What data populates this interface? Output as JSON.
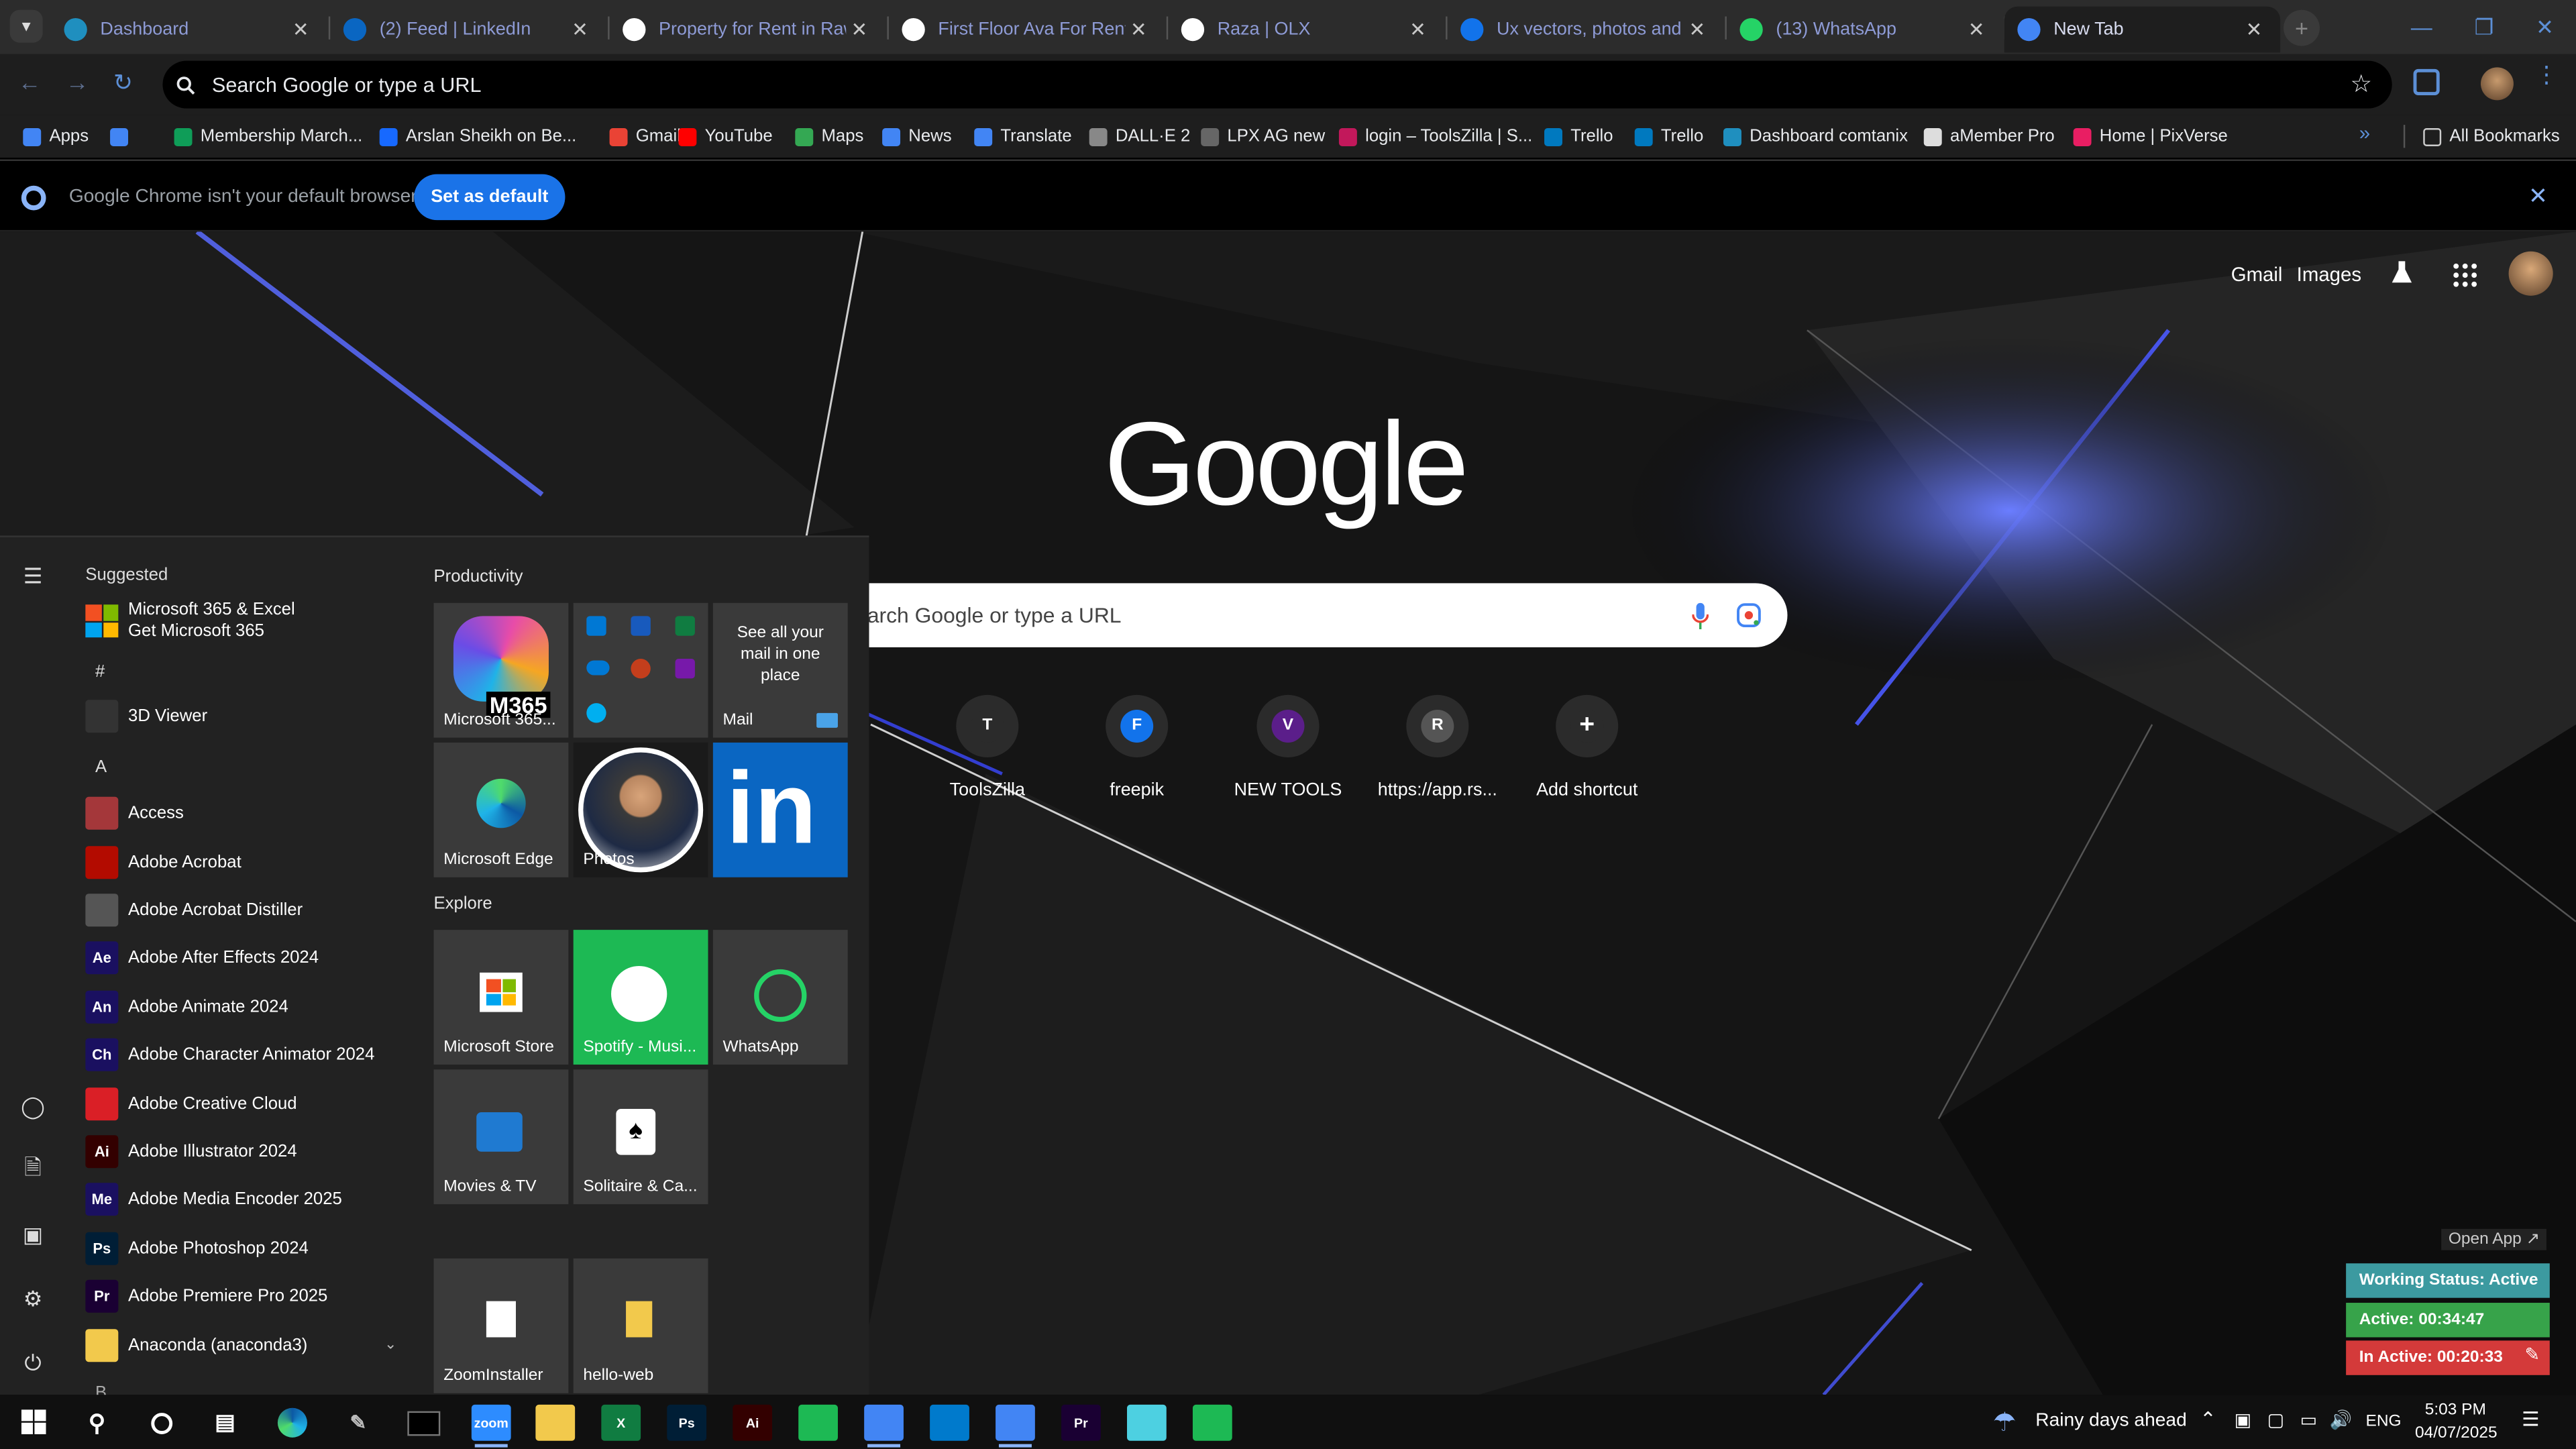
{
  "tabs": [
    {
      "title": "Dashboard",
      "icon": "dashboard-favicon",
      "color": "#1f8fbf"
    },
    {
      "title": "(2) Feed | LinkedIn",
      "icon": "linkedin-favicon",
      "color": "#0a66c2"
    },
    {
      "title": "Property for Rent in Rawa",
      "icon": "olx-favicon",
      "color": "#ffffff"
    },
    {
      "title": "First Floor Ava For Rent A",
      "icon": "olx-favicon",
      "color": "#ffffff"
    },
    {
      "title": "Raza | OLX",
      "icon": "olx-favicon",
      "color": "#ffffff"
    },
    {
      "title": "Ux vectors, photos and PS",
      "icon": "freepik-favicon",
      "color": "#1273eb"
    },
    {
      "title": "(13) WhatsApp",
      "icon": "whatsapp-favicon",
      "color": "#25d366"
    },
    {
      "title": "New Tab",
      "icon": "chrome-favicon",
      "color": "#4285f4"
    }
  ],
  "omnibox": {
    "text": "Search Google or type a URL"
  },
  "bookmarks": [
    {
      "label": "Apps",
      "color": "#4285f4"
    },
    {
      "label": "",
      "color": "#4285f4"
    },
    {
      "label": "Membership March...",
      "color": "#0f9d58"
    },
    {
      "label": "Arslan Sheikh on Be...",
      "color": "#1769ff"
    },
    {
      "label": "Gmail",
      "color": "#ea4335"
    },
    {
      "label": "YouTube",
      "color": "#ff0000"
    },
    {
      "label": "Maps",
      "color": "#34a853"
    },
    {
      "label": "News",
      "color": "#4285f4"
    },
    {
      "label": "Translate",
      "color": "#4285f4"
    },
    {
      "label": "DALL·E 2",
      "color": "#888888"
    },
    {
      "label": "LPX AG new",
      "color": "#666666"
    },
    {
      "label": "login – ToolsZilla | S...",
      "color": "#c2185b"
    },
    {
      "label": "Trello",
      "color": "#0079bf"
    },
    {
      "label": "Trello",
      "color": "#0079bf"
    },
    {
      "label": "Dashboard comtanix",
      "color": "#1f8fbf"
    },
    {
      "label": "aMember Pro",
      "color": "#dddddd"
    },
    {
      "label": "Home | PixVerse",
      "color": "#e91e63"
    }
  ],
  "all_bookmarks": "All Bookmarks",
  "infobar": {
    "message": "Google Chrome isn't your default browser",
    "button": "Set as default"
  },
  "ntp": {
    "links": {
      "gmail": "Gmail",
      "images": "Images"
    },
    "logo": "Google",
    "search_placeholder": "Search Google or type a URL",
    "shortcuts": [
      {
        "label": "ToolsZilla",
        "glyph": "T"
      },
      {
        "label": "freepik",
        "glyph": "F"
      },
      {
        "label": "NEW TOOLS",
        "glyph": "V"
      },
      {
        "label": "https://app.rs...",
        "glyph": "R"
      },
      {
        "label": "Add shortcut",
        "glyph": "+"
      }
    ]
  },
  "startmenu": {
    "suggested_header": "Suggested",
    "suggested": {
      "title": "Microsoft 365 & Excel",
      "subtitle": "Get Microsoft 365"
    },
    "letters": [
      "#",
      "A"
    ],
    "apps": [
      {
        "label": "3D Viewer",
        "badge": "",
        "color": "#333333"
      },
      {
        "label": "Access",
        "badge": "",
        "color": "#a4373a"
      },
      {
        "label": "Adobe Acrobat",
        "badge": "",
        "color": "#b30b00"
      },
      {
        "label": "Adobe Acrobat Distiller",
        "badge": "",
        "color": "#555555"
      },
      {
        "label": "Adobe After Effects 2024",
        "badge": "Ae",
        "color": "#1a1060"
      },
      {
        "label": "Adobe Animate 2024",
        "badge": "An",
        "color": "#1a1060"
      },
      {
        "label": "Adobe Character Animator 2024",
        "badge": "Ch",
        "color": "#1a1060"
      },
      {
        "label": "Adobe Creative Cloud",
        "badge": "",
        "color": "#da1f26"
      },
      {
        "label": "Adobe Illustrator 2024",
        "badge": "Ai",
        "color": "#330000"
      },
      {
        "label": "Adobe Media Encoder 2025",
        "badge": "Me",
        "color": "#1a1060"
      },
      {
        "label": "Adobe Photoshop 2024",
        "badge": "Ps",
        "color": "#001e36"
      },
      {
        "label": "Adobe Premiere Pro 2025",
        "badge": "Pr",
        "color": "#1a0033"
      },
      {
        "label": "Anaconda (anaconda3)",
        "badge": "",
        "color": "#f2c94c"
      }
    ],
    "productivity_header": "Productivity",
    "explore_header": "Explore",
    "tiles": {
      "m365": "Microsoft 365...",
      "m365_badge": "M365",
      "mail_text": "See all your mail in one place",
      "mail": "Mail",
      "edge": "Microsoft Edge",
      "photos": "Photos",
      "linkedin_glyph": "in",
      "store": "Microsoft Store",
      "spotify": "Spotify - Musi...",
      "whatsapp": "WhatsApp",
      "movies": "Movies & TV",
      "solitaire": "Solitaire & Ca...",
      "zoom": "ZoomInstaller",
      "helloweb": "hello-web"
    }
  },
  "widget": {
    "open_app": "Open App ↗",
    "status": "Working Status: Active",
    "active": "Active: 00:34:47",
    "inactive": "In Active: 00:20:33",
    "colors": {
      "status": "#3c9aa0",
      "active": "#37a34a",
      "inactive": "#d43a3a"
    }
  },
  "taskbar": {
    "weather": "Rainy days ahead",
    "lang": "ENG",
    "time": "5:03 PM",
    "date": "04/07/2025",
    "apps": [
      {
        "name": "zoom",
        "glyph": "zoom",
        "color": "#2d8cff"
      },
      {
        "name": "file-explorer",
        "glyph": "",
        "color": "#f2c94c"
      },
      {
        "name": "excel",
        "glyph": "X",
        "color": "#107c41"
      },
      {
        "name": "photoshop",
        "glyph": "Ps",
        "color": "#001e36"
      },
      {
        "name": "illustrator",
        "glyph": "Ai",
        "color": "#330000"
      },
      {
        "name": "app-green",
        "glyph": "",
        "color": "#1db954"
      },
      {
        "name": "chrome",
        "glyph": "",
        "color": "#4285f4"
      },
      {
        "name": "vscode",
        "glyph": "",
        "color": "#007acc"
      },
      {
        "name": "chrome-2",
        "glyph": "",
        "color": "#4285f4"
      },
      {
        "name": "premiere",
        "glyph": "Pr",
        "color": "#1a0033"
      },
      {
        "name": "app-diamond",
        "glyph": "",
        "color": "#4dd0e1"
      },
      {
        "name": "app-green-2",
        "glyph": "",
        "color": "#1db954"
      }
    ]
  }
}
